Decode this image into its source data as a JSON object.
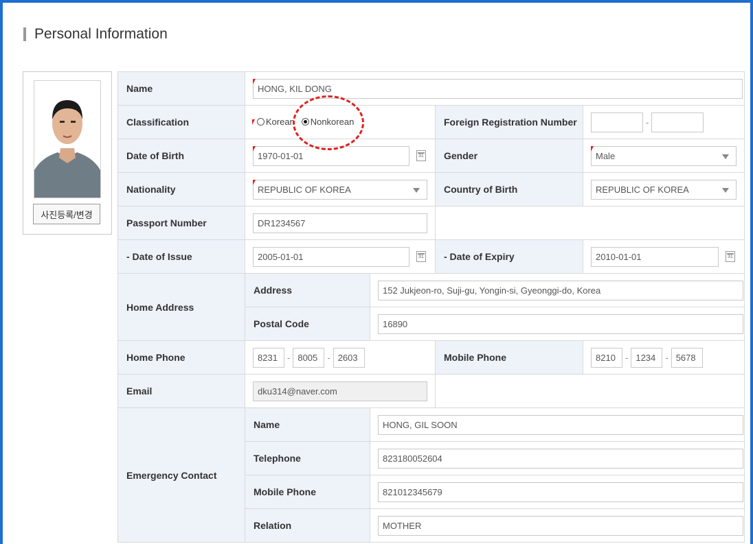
{
  "page": {
    "title": "Personal Information",
    "photo_button": "사진등록/변경"
  },
  "fields": {
    "name": {
      "label": "Name",
      "value": "HONG, KIL DONG"
    },
    "classification": {
      "label": "Classification",
      "options": [
        "Korean",
        "Nonkorean"
      ],
      "selected": "Nonkorean"
    },
    "foreign_reg": {
      "label": "Foreign Registration Number",
      "part1": "",
      "part2": ""
    },
    "dob": {
      "label": "Date of Birth",
      "value": "1970-01-01"
    },
    "gender": {
      "label": "Gender",
      "value": "Male"
    },
    "nationality": {
      "label": "Nationality",
      "value": "REPUBLIC OF KOREA"
    },
    "country_of_birth": {
      "label": "Country of Birth",
      "value": "REPUBLIC OF KOREA"
    },
    "passport": {
      "label": "Passport Number",
      "value": "DR1234567"
    },
    "issue": {
      "label": "- Date of Issue",
      "value": "2005-01-01"
    },
    "expiry": {
      "label": "- Date of Expiry",
      "value": "2010-01-01"
    },
    "home_address": {
      "label": "Home Address",
      "address_label": "Address",
      "address": "152 Jukjeon-ro, Suji-gu, Yongin-si, Gyeonggi-do, Korea",
      "postal_label": "Postal Code",
      "postal": "16890"
    },
    "home_phone": {
      "label": "Home Phone",
      "p1": "8231",
      "p2": "8005",
      "p3": "2603"
    },
    "mobile_phone": {
      "label": "Mobile Phone",
      "p1": "8210",
      "p2": "1234",
      "p3": "5678"
    },
    "email": {
      "label": "Email",
      "value": "dku314@naver.com"
    },
    "emergency": {
      "label": "Emergency Contact",
      "name_label": "Name",
      "name": "HONG, GIL SOON",
      "tel_label": "Telephone",
      "tel": "823180052604",
      "mobile_label": "Mobile Phone",
      "mobile": "821012345679",
      "relation_label": "Relation",
      "relation": "MOTHER"
    }
  },
  "colors": {
    "frame": "#1e6fd0",
    "label_bg": "#eef2f9",
    "required_marker": "#e0201f",
    "annotation": "#e02020"
  }
}
